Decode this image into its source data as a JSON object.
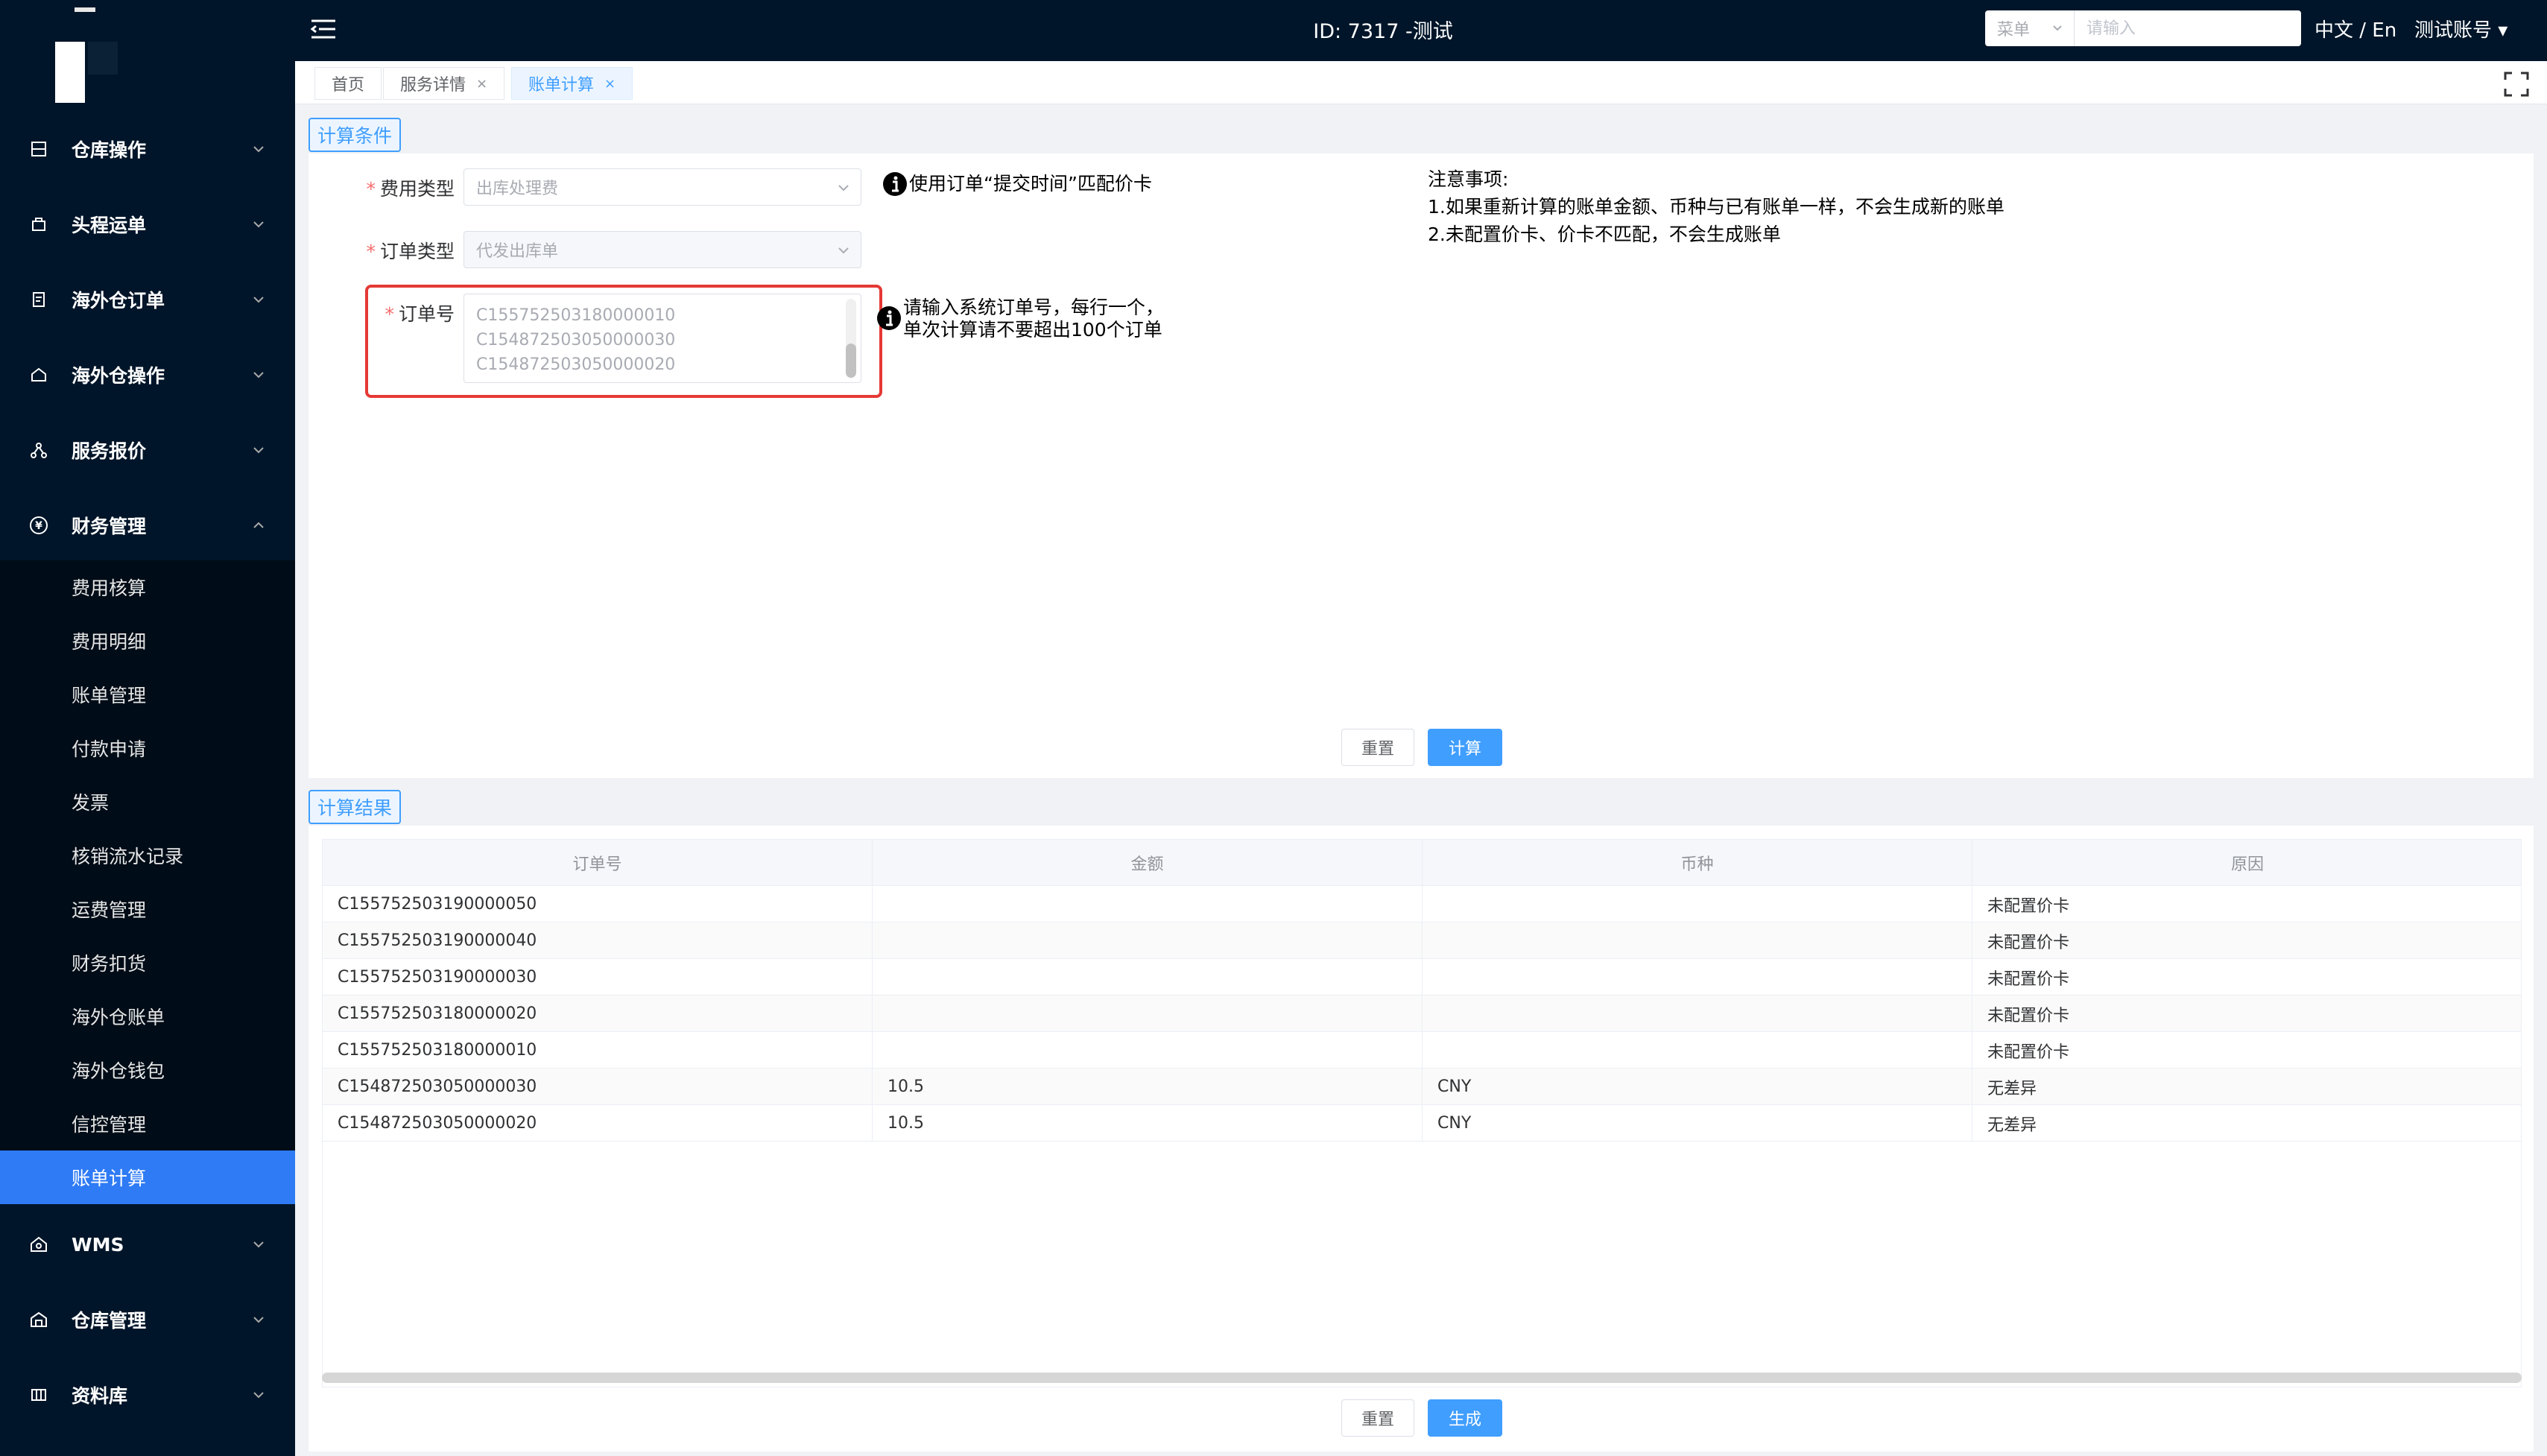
{
  "header": {
    "title": "ID: 7317 -测试",
    "search_select": "菜单",
    "search_placeholder": "请输入",
    "lang": "中文 / En",
    "account": "测试账号 ▾"
  },
  "sidebar": {
    "items": [
      {
        "label": "仓库操作",
        "icon": "warehouse-icon"
      },
      {
        "label": "头程运单",
        "icon": "shipment-icon"
      },
      {
        "label": "海外仓订单",
        "icon": "order-icon"
      },
      {
        "label": "海外仓操作",
        "icon": "overseas-icon"
      },
      {
        "label": "服务报价",
        "icon": "quote-icon"
      },
      {
        "label": "财务管理",
        "icon": "finance-icon"
      },
      {
        "label": "WMS",
        "icon": "wms-icon"
      },
      {
        "label": "仓库管理",
        "icon": "warehouse-manage-icon"
      },
      {
        "label": "资料库",
        "icon": "library-icon"
      }
    ],
    "sub_items": [
      "费用核算",
      "费用明细",
      "账单管理",
      "付款申请",
      "发票",
      "核销流水记录",
      "运费管理",
      "财务扣货",
      "海外仓账单",
      "海外仓钱包",
      "信控管理",
      "账单计算"
    ]
  },
  "tabs": [
    {
      "label": "首页"
    },
    {
      "label": "服务详情",
      "close": "×"
    },
    {
      "label": "账单计算",
      "close": "×"
    }
  ],
  "conditions": {
    "tag": "计算条件",
    "fee_type_label": "费用类型",
    "fee_type_value": "出库处理费",
    "order_type_label": "订单类型",
    "order_type_value": "代发出库单",
    "order_no_label": "订单号",
    "order_no_lines": [
      "C155752503180000010",
      "C154872503050000030",
      "C154872503050000020"
    ],
    "hint_match": "使用订单“提交时间”匹配价卡",
    "hint_input_1": "请输入系统订单号，每行一个，",
    "hint_input_2": "单次计算请不要超出100个订单",
    "notes_title": "注意事项:",
    "notes_1": "1.如果重新计算的账单金额、币种与已有账单一样，不会生成新的账单",
    "notes_2": "2.未配置价卡、价卡不匹配，不会生成账单",
    "reset": "重置",
    "calc": "计算"
  },
  "results": {
    "tag": "计算结果",
    "columns": [
      "订单号",
      "金额",
      "币种",
      "原因"
    ],
    "rows": [
      [
        "C155752503190000050",
        "",
        "",
        "未配置价卡"
      ],
      [
        "C155752503190000040",
        "",
        "",
        "未配置价卡"
      ],
      [
        "C155752503190000030",
        "",
        "",
        "未配置价卡"
      ],
      [
        "C155752503180000020",
        "",
        "",
        "未配置价卡"
      ],
      [
        "C155752503180000010",
        "",
        "",
        "未配置价卡"
      ],
      [
        "C154872503050000030",
        "10.5",
        "CNY",
        "无差异"
      ],
      [
        "C154872503050000020",
        "10.5",
        "CNY",
        "无差异"
      ]
    ],
    "reset": "重置",
    "generate": "生成"
  },
  "colors": {
    "sidebar_bg": "#001529",
    "active": "#2f7bf5",
    "primary": "#409eff",
    "highlight": "#e53935"
  }
}
